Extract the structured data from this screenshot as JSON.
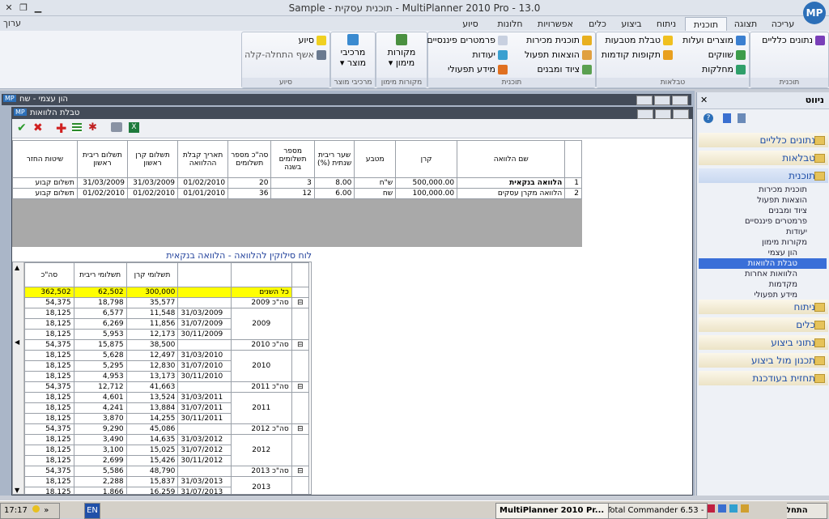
{
  "app": {
    "title": "Sample - תוכנית עסקית - MultiPlanner 2010 Pro - 13.0",
    "logo": "MP",
    "edit_label": "ערוך"
  },
  "ribbon_tabs": [
    "עריכה",
    "תצוגה",
    "תוכנית",
    "ניתוח",
    "ביצוע",
    "כלים",
    "אפשרויות",
    "חלונות",
    "סיוע"
  ],
  "ribbon_active_tab": "תוכנית",
  "ribbon_groups": {
    "tochnit_group": {
      "label": "תוכנית",
      "item": "נתונים כלליים"
    },
    "tables_group": {
      "label": "טבלאות",
      "items": [
        "מוצרים ועלות",
        "טבלת מטבעות",
        "שווקים",
        "תקופות קודמות",
        "מחלקות"
      ]
    },
    "plan_group": {
      "label": "תוכנית",
      "items": [
        "תוכנית מכירות",
        "פרמטרים פיננסיים",
        "הוצאות תפעול",
        "יעודות",
        "ציוד ומבנים",
        "מידע תפעולי"
      ]
    },
    "funding_group": {
      "label": "מקורות מימון",
      "item": "מקורות מימון"
    },
    "product_group": {
      "label": "מרכיבי מוצר",
      "item": "מרכיבי מוצר"
    },
    "help_group": {
      "label": "סיוע",
      "items": [
        "סיוע",
        "אשף התחלה-קלה"
      ]
    }
  },
  "windows": {
    "outer_title": "הון עצמי - שח",
    "inner_title": "טבלת הלוואות"
  },
  "loans_table": {
    "headers": [
      "שם הלוואה",
      "קרן",
      "מטבע",
      "שער ריבית שנתית (%)",
      "מספר תשלומים בשנה",
      "סה\"כ מספר תשלומים",
      "תאריך קבלת ההלוואה",
      "תשלום קרן ראשון",
      "תשלום ריבית ראשון",
      "שיטות החזר"
    ],
    "rows": [
      {
        "idx": "1",
        "name": "הלוואה בנקאית",
        "amount": "500,000.00",
        "currency": "ש\"ח",
        "rate": "8.00",
        "per_year": "3",
        "total": "20",
        "received": "01/02/2010",
        "first_principal": "31/03/2009",
        "first_interest": "31/03/2009",
        "method": "תשלום קבוע"
      },
      {
        "idx": "2",
        "name": "הלוואה מקרן עסקים",
        "amount": "100,000.00",
        "currency": "שח",
        "rate": "6.00",
        "per_year": "12",
        "total": "36",
        "received": "01/01/2010",
        "first_principal": "01/02/2010",
        "first_interest": "01/02/2010",
        "method": "תשלום קבוע"
      }
    ]
  },
  "schedule": {
    "title": "לוח סילוקין להלוואה - הלוואה בנקאית",
    "headers": [
      "",
      "",
      "תשלומי קרן",
      "תשלומי ריבית",
      "סה\"כ"
    ],
    "total_row": {
      "label": "כל השנים",
      "principal": "300,000",
      "interest": "62,502",
      "total": "362,502"
    },
    "years": [
      {
        "label": "סה\"כ 2009",
        "year": "2009",
        "principal": "35,577",
        "interest": "18,798",
        "total": "54,375",
        "rows": [
          {
            "date": "31/03/2009",
            "principal": "11,548",
            "interest": "6,577",
            "total": "18,125"
          },
          {
            "date": "31/07/2009",
            "principal": "11,856",
            "interest": "6,269",
            "total": "18,125"
          },
          {
            "date": "30/11/2009",
            "principal": "12,173",
            "interest": "5,953",
            "total": "18,125"
          }
        ]
      },
      {
        "label": "סה\"כ 2010",
        "year": "2010",
        "principal": "38,500",
        "interest": "15,875",
        "total": "54,375",
        "rows": [
          {
            "date": "31/03/2010",
            "principal": "12,497",
            "interest": "5,628",
            "total": "18,125"
          },
          {
            "date": "31/07/2010",
            "principal": "12,830",
            "interest": "5,295",
            "total": "18,125"
          },
          {
            "date": "30/11/2010",
            "principal": "13,173",
            "interest": "4,953",
            "total": "18,125"
          }
        ]
      },
      {
        "label": "סה\"כ 2011",
        "year": "2011",
        "principal": "41,663",
        "interest": "12,712",
        "total": "54,375",
        "rows": [
          {
            "date": "31/03/2011",
            "principal": "13,524",
            "interest": "4,601",
            "total": "18,125"
          },
          {
            "date": "31/07/2011",
            "principal": "13,884",
            "interest": "4,241",
            "total": "18,125"
          },
          {
            "date": "30/11/2011",
            "principal": "14,255",
            "interest": "3,870",
            "total": "18,125"
          }
        ]
      },
      {
        "label": "סה\"כ 2012",
        "year": "2012",
        "principal": "45,086",
        "interest": "9,290",
        "total": "54,375",
        "rows": [
          {
            "date": "31/03/2012",
            "principal": "14,635",
            "interest": "3,490",
            "total": "18,125"
          },
          {
            "date": "31/07/2012",
            "principal": "15,025",
            "interest": "3,100",
            "total": "18,125"
          },
          {
            "date": "30/11/2012",
            "principal": "15,426",
            "interest": "2,699",
            "total": "18,125"
          }
        ]
      },
      {
        "label": "סה\"כ 2013",
        "year": "2013",
        "principal": "48,790",
        "interest": "5,586",
        "total": "54,375",
        "rows": [
          {
            "date": "31/03/2013",
            "principal": "15,837",
            "interest": "2,288",
            "total": "18,125"
          },
          {
            "date": "31/07/2013",
            "principal": "16,259",
            "interest": "1,866",
            "total": "18,125"
          }
        ]
      }
    ]
  },
  "side_panel": {
    "title": "ניווט",
    "categories": [
      {
        "label": "נתונים כלליים"
      },
      {
        "label": "טבלאות"
      },
      {
        "label": "תוכנית",
        "active": true
      }
    ],
    "plan_items": [
      "תוכנית מכירות",
      "הוצאות תפעול",
      "ציוד ומבנים",
      "פרמטרים פיננסיים",
      "יעודות",
      "מקורות מימון",
      "הון עצמי",
      "טבלת הלוואות",
      "הלוואות אחרות",
      "מקדמות",
      "מידע תפעולי"
    ],
    "selected_item": "טבלת הלוואות",
    "bottom_categories": [
      "ניתוח",
      "כלים",
      "נתוני ביצוע",
      "תכנון מול ביצוע",
      "תחזית בעודכנת"
    ]
  },
  "taskbar": {
    "start": "התחל",
    "tasks": [
      "MultiPlanner 2010 Pr...",
      "Total Commander 6.53 - ..."
    ],
    "lang": "EN",
    "time": "17:17"
  },
  "colors": {
    "accent": "#1f4fa8",
    "selection": "#3a6fd8",
    "total_row": "#ffff00"
  }
}
